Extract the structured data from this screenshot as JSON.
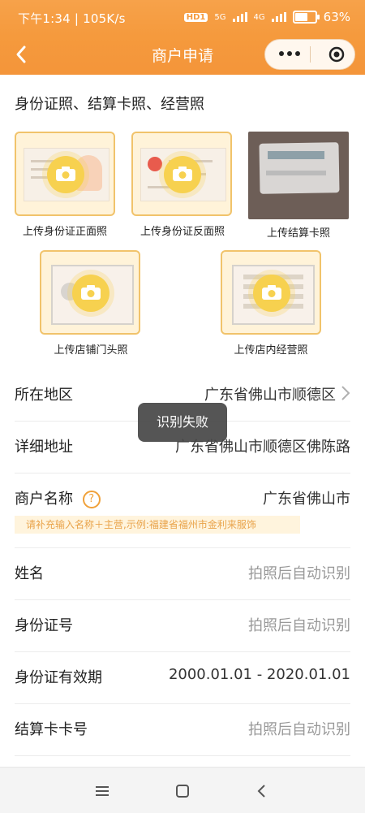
{
  "status": {
    "time": "下午1:34",
    "speed": "105K/s",
    "hd": "HD1",
    "net1": "5G",
    "net2": "4G",
    "battery": "63%"
  },
  "navbar": {
    "title": "商户申请"
  },
  "uploads": {
    "section_title": "身份证照、结算卡照、经营照",
    "items": [
      {
        "label": "上传身份证正面照"
      },
      {
        "label": "上传身份证反面照"
      },
      {
        "label": "上传结算卡照"
      },
      {
        "label": "上传店铺门头照"
      },
      {
        "label": "上传店内经营照"
      }
    ]
  },
  "form": {
    "region": {
      "label": "所在地区",
      "value": "广东省佛山市顺德区"
    },
    "address": {
      "label": "详细地址",
      "value": "广东省佛山市顺德区佛陈路"
    },
    "merchant_name": {
      "label": "商户名称",
      "value": "广东省佛山市",
      "help": "?",
      "tip": "请补充输入名称＋主营,示例:福建省福州市金利来服饰"
    },
    "name": {
      "label": "姓名",
      "placeholder": "拍照后自动识别"
    },
    "id_number": {
      "label": "身份证号",
      "placeholder": "拍照后自动识别"
    },
    "id_validity": {
      "label": "身份证有效期",
      "value": "2000.01.01 - 2020.01.01"
    },
    "card_number": {
      "label": "结算卡卡号",
      "placeholder": "拍照后自动识别"
    }
  },
  "toast": {
    "text": "识别失败"
  },
  "colors": {
    "accent": "#F59A3D",
    "tip_bg": "#FFF4DD",
    "tip_text": "#E9A34A"
  }
}
